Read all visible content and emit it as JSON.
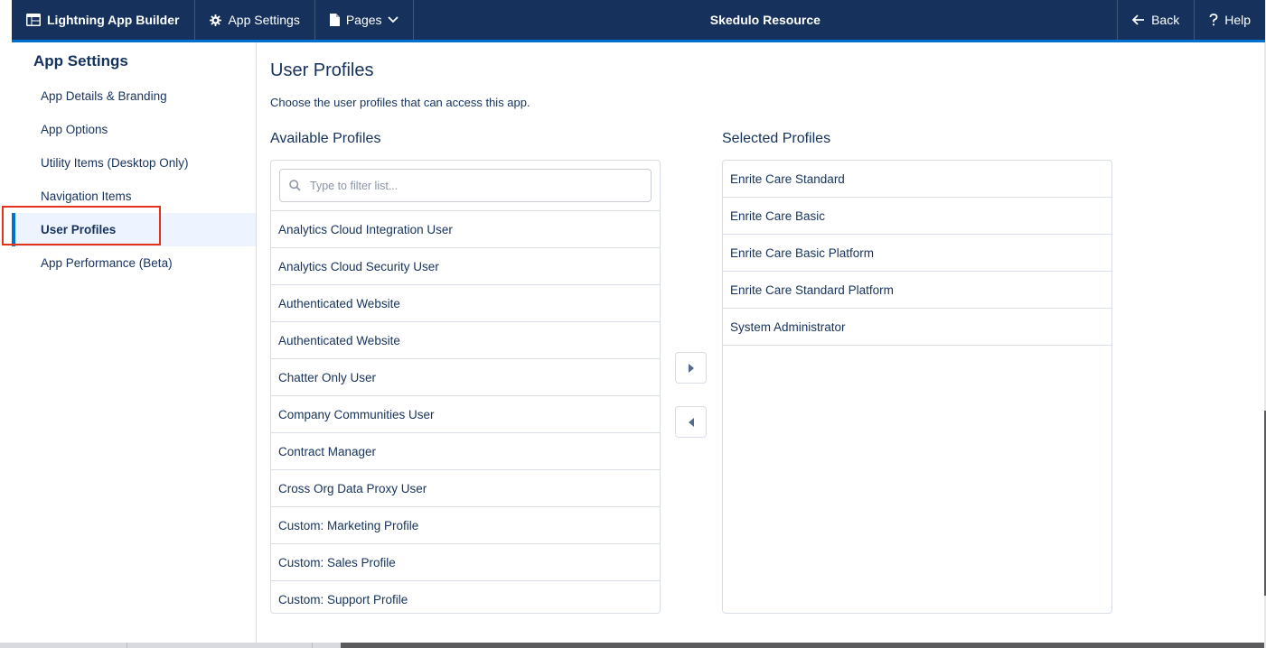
{
  "header": {
    "brand_label": "Lightning App Builder",
    "app_settings_label": "App Settings",
    "pages_label": "Pages",
    "title": "Skedulo Resource",
    "back_label": "Back",
    "help_label": "Help",
    "colors": {
      "header_bg": "#16325c",
      "accent": "#0070d2"
    }
  },
  "sidebar": {
    "title": "App Settings",
    "items": [
      {
        "label": "App Details & Branding",
        "active": false
      },
      {
        "label": "App Options",
        "active": false
      },
      {
        "label": "Utility Items (Desktop Only)",
        "active": false
      },
      {
        "label": "Navigation Items",
        "active": false
      },
      {
        "label": "User Profiles",
        "active": true
      },
      {
        "label": "App Performance (Beta)",
        "active": false
      }
    ]
  },
  "main": {
    "title": "User Profiles",
    "description": "Choose the user profiles that can access this app.",
    "available": {
      "label": "Available Profiles",
      "filter_placeholder": "Type to filter list...",
      "items": [
        "Analytics Cloud Integration User",
        "Analytics Cloud Security User",
        "Authenticated Website",
        "Authenticated Website",
        "Chatter Only User",
        "Company Communities User",
        "Contract Manager",
        "Cross Org Data Proxy User",
        "Custom: Marketing Profile",
        "Custom: Sales Profile",
        "Custom: Support Profile"
      ]
    },
    "selected": {
      "label": "Selected Profiles",
      "items": [
        "Enrite Care Standard",
        "Enrite Care Basic",
        "Enrite Care Basic Platform",
        "Enrite Care Standard Platform",
        "System Administrator"
      ]
    },
    "move_right_icon": "triangle-right-icon",
    "move_left_icon": "triangle-left-icon"
  }
}
